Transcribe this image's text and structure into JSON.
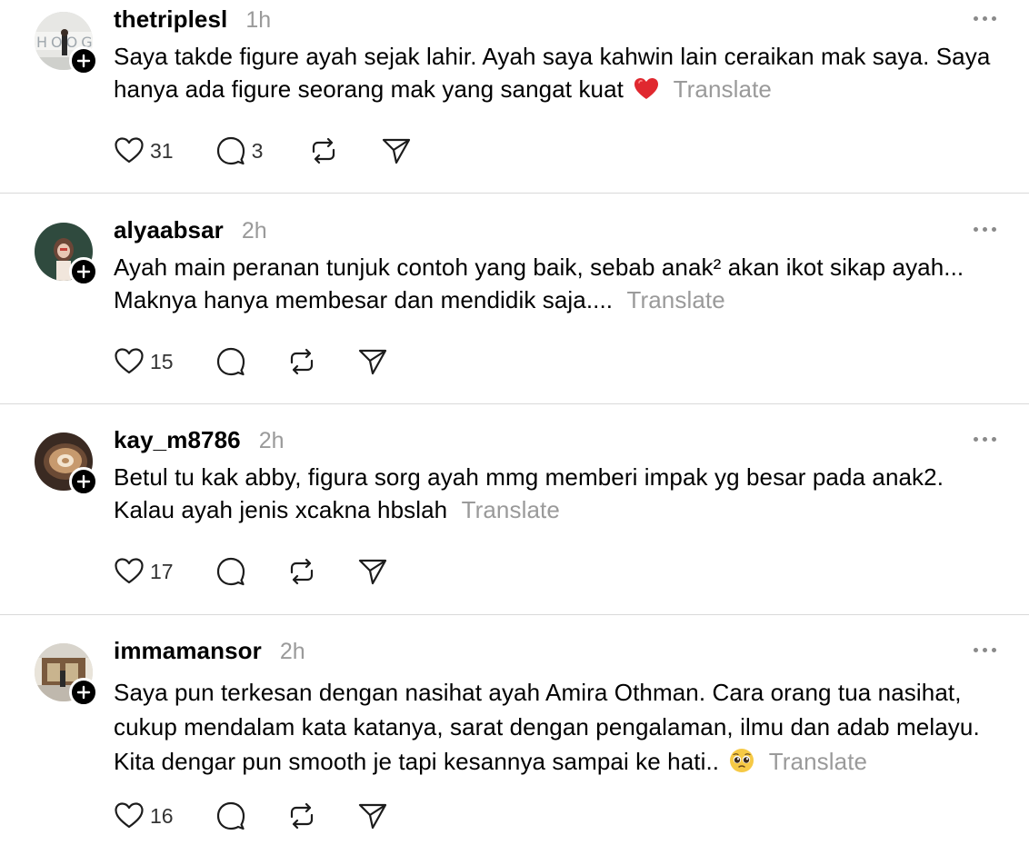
{
  "posts": [
    {
      "username": "thetriplesl",
      "time": "1h",
      "text": "Saya takde figure ayah sejak lahir. Ayah saya kahwin lain ceraikan mak saya. Saya hanya ada figure seorang mak yang sangat kuat",
      "emoji": "red-heart-icon",
      "translate": "Translate",
      "likes": "31",
      "replies": "3"
    },
    {
      "username": "alyaabsar",
      "time": "2h",
      "text": "Ayah main peranan tunjuk contoh yang baik, sebab anak² akan ikot sikap ayah... Maknya hanya membesar dan mendidik saja....",
      "translate": "Translate",
      "likes": "15",
      "replies": ""
    },
    {
      "username": "kay_m8786",
      "time": "2h",
      "text": "Betul tu kak abby, figura sorg ayah mmg memberi impak yg besar pada anak2. Kalau ayah jenis xcakna hbslah",
      "translate": "Translate",
      "likes": "17",
      "replies": ""
    },
    {
      "username": "immamansor",
      "time": "2h",
      "text": "Saya pun terkesan dengan nasihat ayah Amira Othman. Cara orang tua nasihat, cukup mendalam kata katanya, sarat dengan pengalaman, ilmu dan adab melayu. Kita dengar pun smooth je tapi kesannya sampai ke hati..",
      "emoji": "pleading-face-icon",
      "translate": "Translate",
      "likes": "16",
      "replies": ""
    }
  ]
}
